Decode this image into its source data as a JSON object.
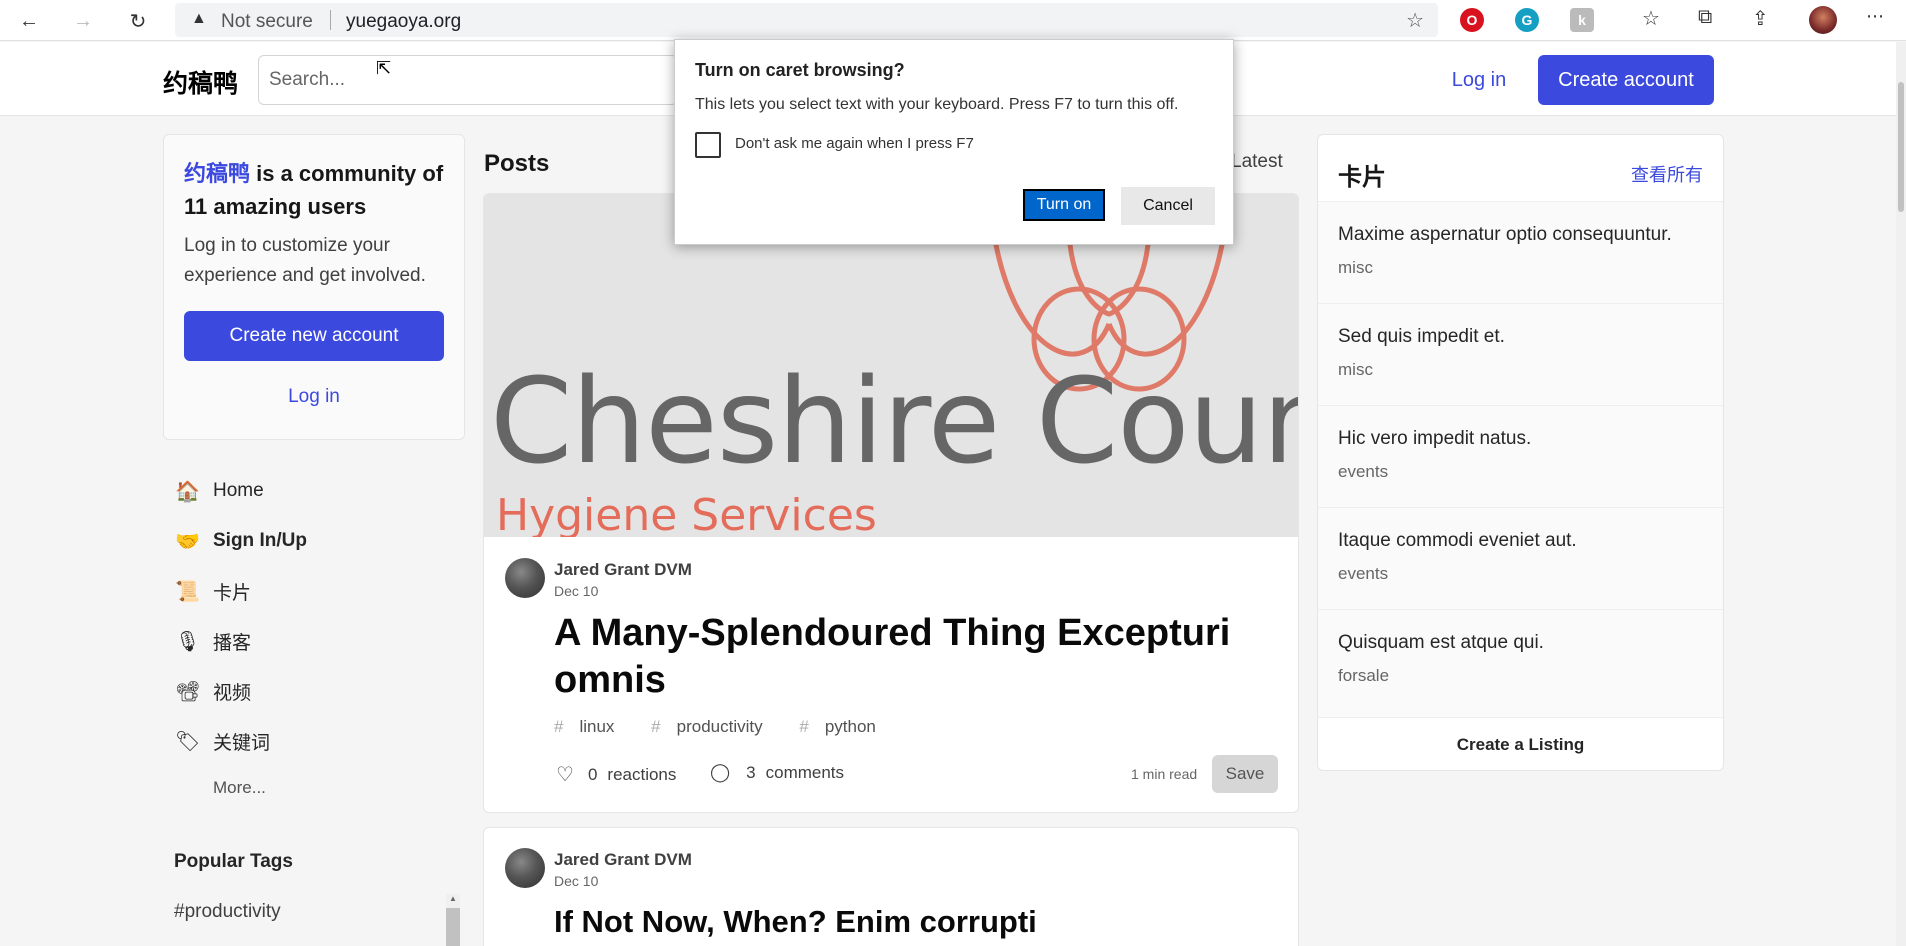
{
  "browser": {
    "security_label": "Not secure",
    "url": "yuegaoya.org"
  },
  "header": {
    "logo": "约稿鸭",
    "search_placeholder": "Search...",
    "login": "Log in",
    "create_account": "Create account"
  },
  "welcome": {
    "brand": "约稿鸭",
    "headline_rest": " is a community of 11 amazing users",
    "body": "Log in to customize your experience and get involved.",
    "cta": "Create new account",
    "login": "Log in"
  },
  "nav": {
    "items": [
      {
        "icon": "🏠",
        "label": "Home"
      },
      {
        "icon": "🤝",
        "label": "Sign In/Up"
      },
      {
        "icon": "📜",
        "label": "卡片"
      },
      {
        "icon": "🎙",
        "label": "播客"
      },
      {
        "icon": "📽",
        "label": "视频"
      },
      {
        "icon": "🏷",
        "label": "关键词"
      }
    ],
    "more": "More..."
  },
  "popular": {
    "title": "Popular Tags",
    "first_tag": "#productivity"
  },
  "feed": {
    "title": "Posts",
    "sort": "Latest",
    "post1": {
      "cover_title": "Cheshire County",
      "cover_subtitle": "Hygiene Services",
      "author": "Jared Grant DVM",
      "date": "Dec 10",
      "title": "A Many-Splendoured Thing Excepturi omnis",
      "tags": [
        "linux",
        "productivity",
        "python"
      ],
      "reactions_count": "0",
      "reactions_label": "reactions",
      "comments_count": "3",
      "comments_label": "comments",
      "read_time": "1 min read",
      "save": "Save"
    },
    "post2": {
      "author": "Jared Grant DVM",
      "date": "Dec 10",
      "title": "If Not Now, When? Enim corrupti"
    }
  },
  "listings": {
    "title": "卡片",
    "see_all": "查看所有",
    "items": [
      {
        "title": "Maxime aspernatur optio consequuntur.",
        "category": "misc"
      },
      {
        "title": "Sed quis impedit et.",
        "category": "misc"
      },
      {
        "title": "Hic vero impedit natus.",
        "category": "events"
      },
      {
        "title": "Itaque commodi eveniet aut.",
        "category": "events"
      },
      {
        "title": "Quisquam est atque qui.",
        "category": "forsale"
      }
    ],
    "footer": "Create a Listing"
  },
  "dialog": {
    "title": "Turn on caret browsing?",
    "message": "This lets you select text with your keyboard. Press F7 to turn this off.",
    "checkbox_label": "Don't ask me again when I press F7",
    "confirm": "Turn on",
    "cancel": "Cancel"
  },
  "colors": {
    "accent": "#3b49df",
    "dialog_primary": "#0066cc"
  }
}
